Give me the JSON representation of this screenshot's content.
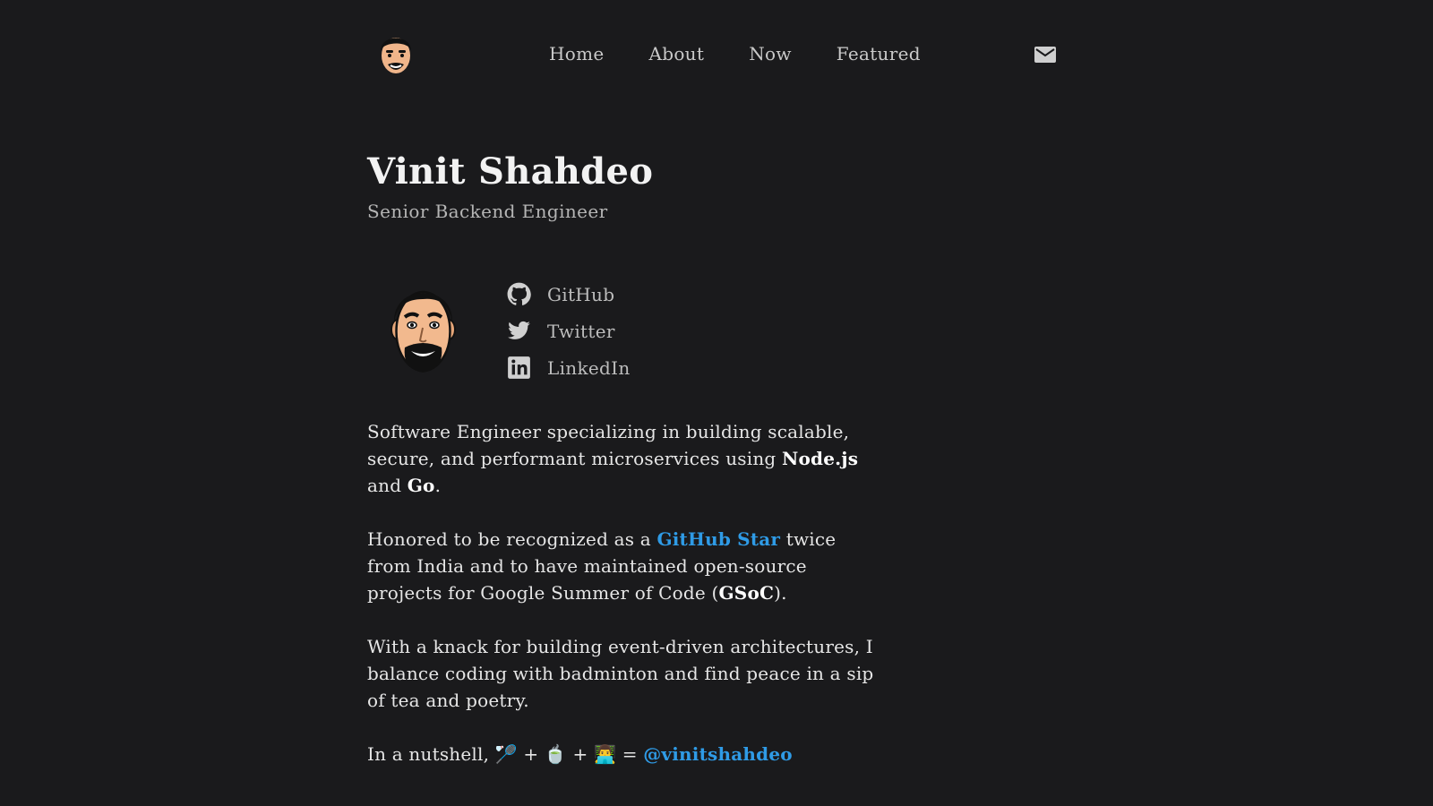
{
  "nav": {
    "items": [
      "Home",
      "About",
      "Now",
      "Featured"
    ]
  },
  "header": {
    "logo_icon": "avatar-logo-icon",
    "mail_icon": "mail-icon"
  },
  "profile": {
    "name": "Vinit Shahdeo",
    "role": "Senior Backend Engineer"
  },
  "social": [
    {
      "label": "GitHub",
      "icon": "github-icon"
    },
    {
      "label": "Twitter",
      "icon": "twitter-icon"
    },
    {
      "label": "LinkedIn",
      "icon": "linkedin-icon"
    }
  ],
  "bio": {
    "p1": {
      "pre": "Software Engineer specializing in building scalable, secure, and performant microservices using ",
      "strong1": "Node.js",
      "mid": " and ",
      "strong2": "Go",
      "post": "."
    },
    "p2": {
      "pre": "Honored to be recognized as a ",
      "link": "GitHub Star",
      "mid": " twice from India and to have maintained open-source projects for Google Summer of Code (",
      "strong": "GSoC",
      "post": ")."
    },
    "p3": {
      "text": "With a knack for building event-driven architectures, I balance coding with badminton and find peace in a sip of tea and poetry."
    },
    "p4": {
      "pre": "In a nutshell, 🏸 + 🍵 + 👨‍💻 = ",
      "link": "@vinitshahdeo"
    }
  },
  "colors": {
    "background": "#1a1a1c",
    "link": "#2f9be6",
    "text": "#e6e6e6",
    "muted": "#b5b5b5"
  }
}
